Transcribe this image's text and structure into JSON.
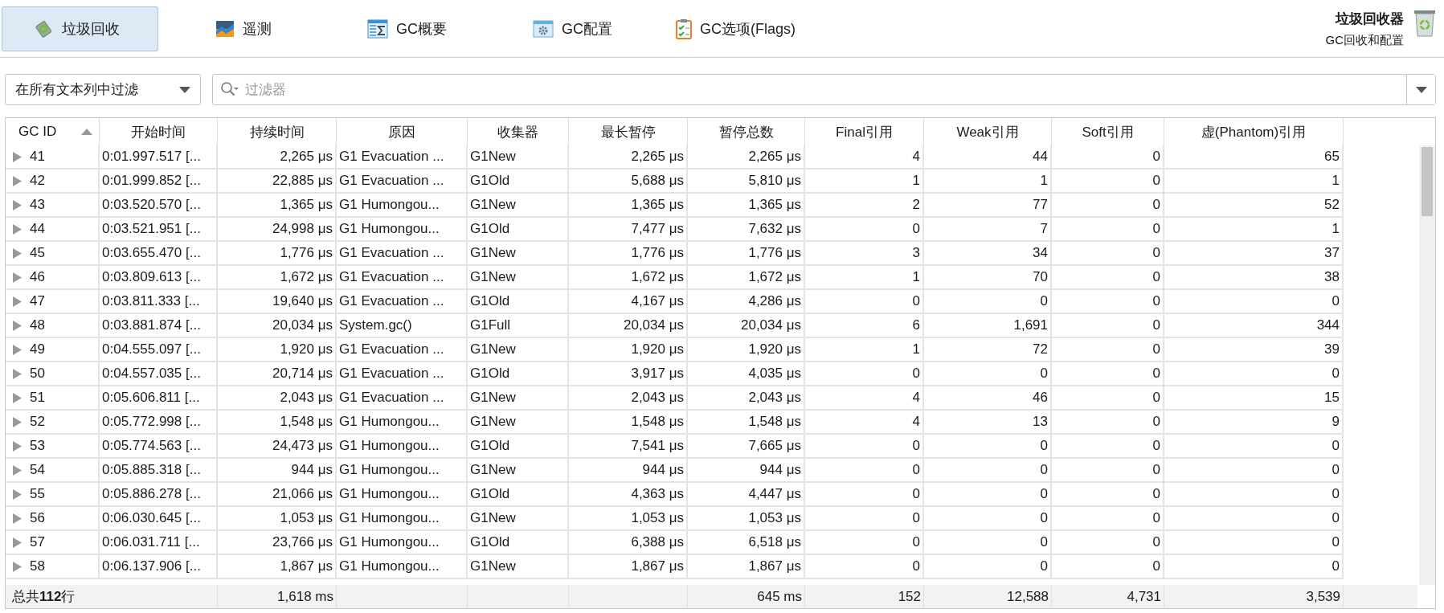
{
  "toolbar": {
    "tabs": [
      {
        "label": "垃圾回收",
        "selected": true
      },
      {
        "label": "遥测",
        "selected": false
      },
      {
        "label": "GC概要",
        "selected": false
      },
      {
        "label": "GC配置",
        "selected": false
      },
      {
        "label": "GC选项(Flags)",
        "selected": false
      }
    ],
    "title": "垃圾回收器",
    "subtitle": "GC回收和配置"
  },
  "filter": {
    "scope": "在所有文本列中过滤",
    "placeholder": "过滤器"
  },
  "table": {
    "columns": [
      {
        "label": "GC ID",
        "kind": "text",
        "sorted": true
      },
      {
        "label": "开始时间",
        "kind": "text",
        "sorted": false
      },
      {
        "label": "持续时间",
        "kind": "number",
        "sorted": false
      },
      {
        "label": "原因",
        "kind": "text",
        "sorted": false
      },
      {
        "label": "收集器",
        "kind": "text",
        "sorted": false
      },
      {
        "label": "最长暂停",
        "kind": "number",
        "sorted": false
      },
      {
        "label": "暂停总数",
        "kind": "number",
        "sorted": false
      },
      {
        "label": "Final引用",
        "kind": "number",
        "sorted": false
      },
      {
        "label": "Weak引用",
        "kind": "number",
        "sorted": false
      },
      {
        "label": "Soft引用",
        "kind": "number",
        "sorted": false
      },
      {
        "label": "虚(Phantom)引用",
        "kind": "number",
        "sorted": false
      }
    ],
    "rows": [
      {
        "expanded": false,
        "cells": [
          "41",
          "0:01.997.517 [...",
          "2,265 μs",
          "G1 Evacuation ...",
          "G1New",
          "2,265 μs",
          "2,265 μs",
          "4",
          "44",
          "0",
          "65"
        ]
      },
      {
        "expanded": false,
        "cells": [
          "42",
          "0:01.999.852 [...",
          "22,885 μs",
          "G1 Evacuation ...",
          "G1Old",
          "5,688 μs",
          "5,810 μs",
          "1",
          "1",
          "0",
          "1"
        ]
      },
      {
        "expanded": false,
        "cells": [
          "43",
          "0:03.520.570 [...",
          "1,365 μs",
          "G1 Humongou...",
          "G1New",
          "1,365 μs",
          "1,365 μs",
          "2",
          "77",
          "0",
          "52"
        ]
      },
      {
        "expanded": false,
        "cells": [
          "44",
          "0:03.521.951 [...",
          "24,998 μs",
          "G1 Humongou...",
          "G1Old",
          "7,477 μs",
          "7,632 μs",
          "0",
          "7",
          "0",
          "1"
        ]
      },
      {
        "expanded": false,
        "cells": [
          "45",
          "0:03.655.470 [...",
          "1,776 μs",
          "G1 Evacuation ...",
          "G1New",
          "1,776 μs",
          "1,776 μs",
          "3",
          "34",
          "0",
          "37"
        ]
      },
      {
        "expanded": false,
        "cells": [
          "46",
          "0:03.809.613 [...",
          "1,672 μs",
          "G1 Evacuation ...",
          "G1New",
          "1,672 μs",
          "1,672 μs",
          "1",
          "70",
          "0",
          "38"
        ]
      },
      {
        "expanded": false,
        "cells": [
          "47",
          "0:03.811.333 [...",
          "19,640 μs",
          "G1 Evacuation ...",
          "G1Old",
          "4,167 μs",
          "4,286 μs",
          "0",
          "0",
          "0",
          "0"
        ]
      },
      {
        "expanded": false,
        "cells": [
          "48",
          "0:03.881.874 [...",
          "20,034 μs",
          "System.gc()",
          "G1Full",
          "20,034 μs",
          "20,034 μs",
          "6",
          "1,691",
          "0",
          "344"
        ]
      },
      {
        "expanded": false,
        "cells": [
          "49",
          "0:04.555.097 [...",
          "1,920 μs",
          "G1 Evacuation ...",
          "G1New",
          "1,920 μs",
          "1,920 μs",
          "1",
          "72",
          "0",
          "39"
        ]
      },
      {
        "expanded": false,
        "cells": [
          "50",
          "0:04.557.035 [...",
          "20,714 μs",
          "G1 Evacuation ...",
          "G1Old",
          "3,917 μs",
          "4,035 μs",
          "0",
          "0",
          "0",
          "0"
        ]
      },
      {
        "expanded": false,
        "cells": [
          "51",
          "0:05.606.811 [...",
          "2,043 μs",
          "G1 Evacuation ...",
          "G1New",
          "2,043 μs",
          "2,043 μs",
          "4",
          "46",
          "0",
          "15"
        ]
      },
      {
        "expanded": false,
        "cells": [
          "52",
          "0:05.772.998 [...",
          "1,548 μs",
          "G1 Humongou...",
          "G1New",
          "1,548 μs",
          "1,548 μs",
          "4",
          "13",
          "0",
          "9"
        ]
      },
      {
        "expanded": false,
        "cells": [
          "53",
          "0:05.774.563 [...",
          "24,473 μs",
          "G1 Humongou...",
          "G1Old",
          "7,541 μs",
          "7,665 μs",
          "0",
          "0",
          "0",
          "0"
        ]
      },
      {
        "expanded": false,
        "cells": [
          "54",
          "0:05.885.318 [...",
          "944 μs",
          "G1 Humongou...",
          "G1New",
          "944 μs",
          "944 μs",
          "0",
          "0",
          "0",
          "0"
        ]
      },
      {
        "expanded": false,
        "cells": [
          "55",
          "0:05.886.278 [...",
          "21,066 μs",
          "G1 Humongou...",
          "G1Old",
          "4,363 μs",
          "4,447 μs",
          "0",
          "0",
          "0",
          "0"
        ]
      },
      {
        "expanded": false,
        "cells": [
          "56",
          "0:06.030.645 [...",
          "1,053 μs",
          "G1 Humongou...",
          "G1New",
          "1,053 μs",
          "1,053 μs",
          "0",
          "0",
          "0",
          "0"
        ]
      },
      {
        "expanded": false,
        "cells": [
          "57",
          "0:06.031.711 [...",
          "23,766 μs",
          "G1 Humongou...",
          "G1Old",
          "6,388 μs",
          "6,518 μs",
          "0",
          "0",
          "0",
          "0"
        ]
      },
      {
        "expanded": false,
        "cells": [
          "58",
          "0:06.137.906 [...",
          "1,867 μs",
          "G1 Humongou...",
          "G1New",
          "1,867 μs",
          "1,867 μs",
          "0",
          "0",
          "0",
          "0"
        ]
      }
    ],
    "footer": {
      "label": "总共**112**行",
      "cells": [
        "1,618 ms",
        null,
        null,
        null,
        "645 ms",
        "152",
        "12,588",
        "4,731",
        "3,539"
      ]
    }
  }
}
